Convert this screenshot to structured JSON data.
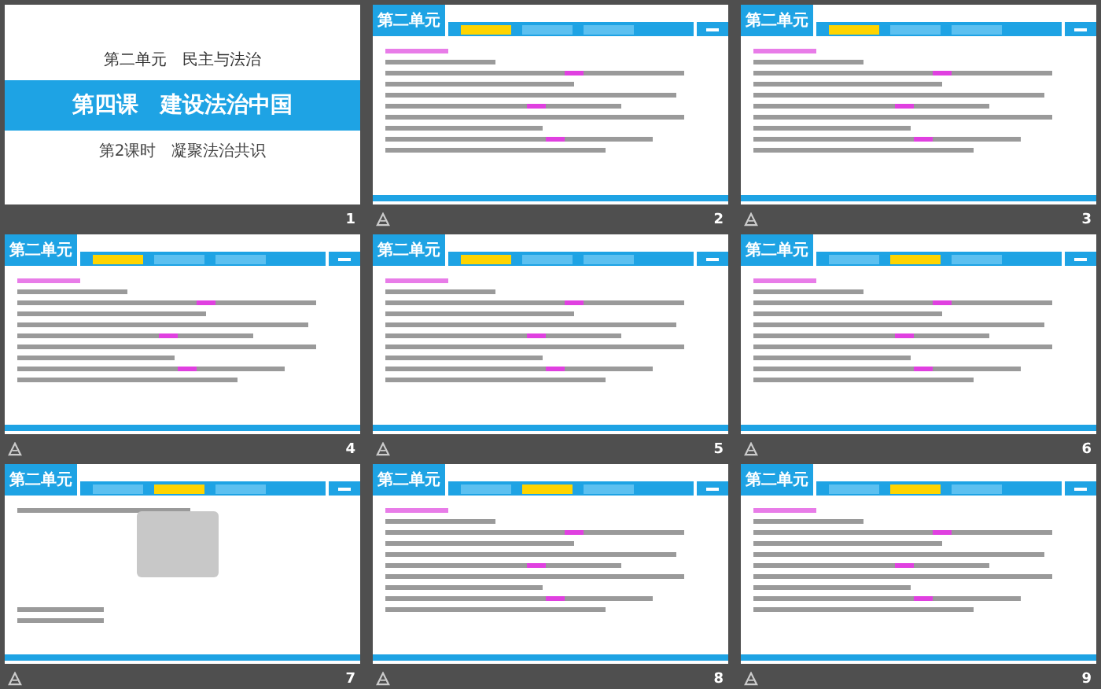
{
  "title_slide": {
    "number": "1",
    "kind": "title",
    "animated": false,
    "unit": "第二单元　民主与法治",
    "title": "第四课　建设法治中国",
    "subtitle": "第2课时　凝聚法治共识"
  },
  "slides": [
    {
      "number": "2",
      "kind": "text",
      "animated": true,
      "unit": "第二单元",
      "tabs": [
        {
          "selected": true
        },
        {
          "selected": false
        },
        {
          "selected": false
        }
      ]
    },
    {
      "number": "3",
      "kind": "text",
      "animated": true,
      "unit": "第二单元",
      "tabs": [
        {
          "selected": true
        },
        {
          "selected": false
        },
        {
          "selected": false
        }
      ]
    },
    {
      "number": "4",
      "kind": "text",
      "animated": true,
      "unit": "第二单元",
      "tabs": [
        {
          "selected": true
        },
        {
          "selected": false
        },
        {
          "selected": false
        }
      ]
    },
    {
      "number": "5",
      "kind": "text",
      "animated": true,
      "unit": "第二单元",
      "tabs": [
        {
          "selected": true
        },
        {
          "selected": false
        },
        {
          "selected": false
        }
      ]
    },
    {
      "number": "6",
      "kind": "text",
      "animated": true,
      "unit": "第二单元",
      "tabs": [
        {
          "selected": false
        },
        {
          "selected": true
        },
        {
          "selected": false
        }
      ]
    },
    {
      "number": "7",
      "kind": "picture",
      "animated": true,
      "unit": "第二单元",
      "tabs": [
        {
          "selected": false
        },
        {
          "selected": true
        },
        {
          "selected": false
        }
      ]
    },
    {
      "number": "8",
      "kind": "text",
      "animated": true,
      "unit": "第二单元",
      "tabs": [
        {
          "selected": false
        },
        {
          "selected": true
        },
        {
          "selected": false
        }
      ]
    },
    {
      "number": "9",
      "kind": "text",
      "animated": true,
      "unit": "第二单元",
      "tabs": [
        {
          "selected": false
        },
        {
          "selected": true
        },
        {
          "selected": false
        }
      ]
    }
  ]
}
